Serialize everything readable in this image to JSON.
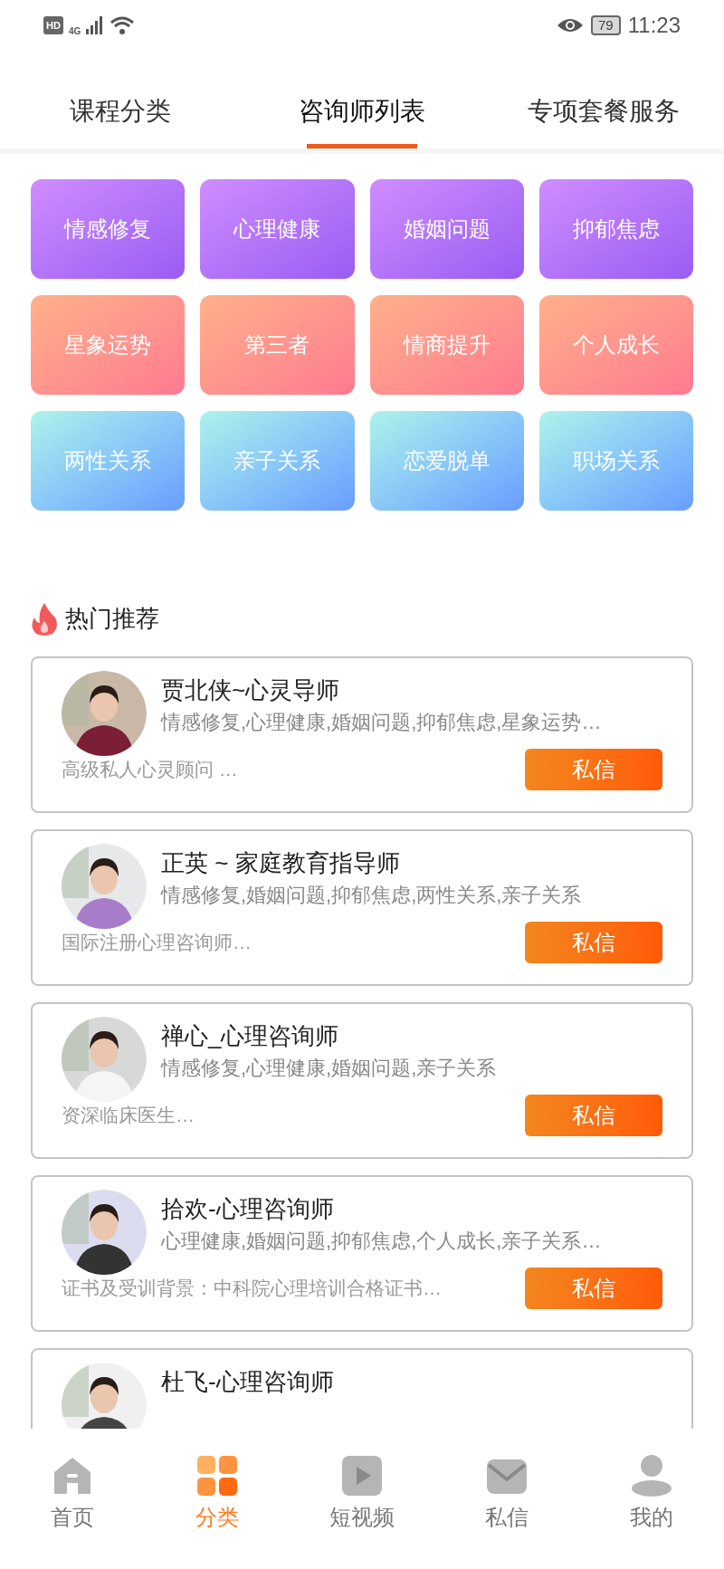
{
  "status_bar": {
    "hd": "HD",
    "network": "4G",
    "battery": "79",
    "time": "11:23"
  },
  "tabs": [
    {
      "label": "课程分类",
      "selected": false
    },
    {
      "label": "咨询师列表",
      "selected": true
    },
    {
      "label": "专项套餐服务",
      "selected": false
    }
  ],
  "categories": [
    {
      "label": "情感修复",
      "kind": "purple"
    },
    {
      "label": "心理健康",
      "kind": "purple"
    },
    {
      "label": "婚姻问题",
      "kind": "purple"
    },
    {
      "label": "抑郁焦虑",
      "kind": "purple"
    },
    {
      "label": "星象运势",
      "kind": "coral"
    },
    {
      "label": "第三者",
      "kind": "coral"
    },
    {
      "label": "情商提升",
      "kind": "coral"
    },
    {
      "label": "个人成长",
      "kind": "coral"
    },
    {
      "label": "两性关系",
      "kind": "blue"
    },
    {
      "label": "亲子关系",
      "kind": "blue"
    },
    {
      "label": "恋爱脱单",
      "kind": "blue"
    },
    {
      "label": "职场关系",
      "kind": "blue"
    }
  ],
  "section_title": "热门推荐",
  "counselors": [
    {
      "name": "贾北侠~心灵导师",
      "tags": "情感修复,心理健康,婚姻问题,抑郁焦虑,星象运势…",
      "bio": "高级私人心灵顾问 …",
      "button": "私信"
    },
    {
      "name": "正英 ~ 家庭教育指导师",
      "tags": "情感修复,婚姻问题,抑郁焦虑,两性关系,亲子关系",
      "bio": "国际注册心理咨询师…",
      "button": "私信"
    },
    {
      "name": "禅心_心理咨询师",
      "tags": "情感修复,心理健康,婚姻问题,亲子关系",
      "bio": "资深临床医生…",
      "button": "私信"
    },
    {
      "name": "拾欢-心理咨询师",
      "tags": "心理健康,婚姻问题,抑郁焦虑,个人成长,亲子关系…",
      "bio": "证书及受训背景：中科院心理培训合格证书…",
      "button": "私信"
    },
    {
      "name": "杜飞-心理咨询师"
    }
  ],
  "bottom_nav": [
    {
      "label": "首页",
      "selected": false,
      "kind": "home"
    },
    {
      "label": "分类",
      "selected": true,
      "kind": "grid"
    },
    {
      "label": "短视频",
      "selected": false,
      "kind": "video"
    },
    {
      "label": "私信",
      "selected": false,
      "kind": "mail"
    },
    {
      "label": "我的",
      "selected": false,
      "kind": "user"
    }
  ]
}
